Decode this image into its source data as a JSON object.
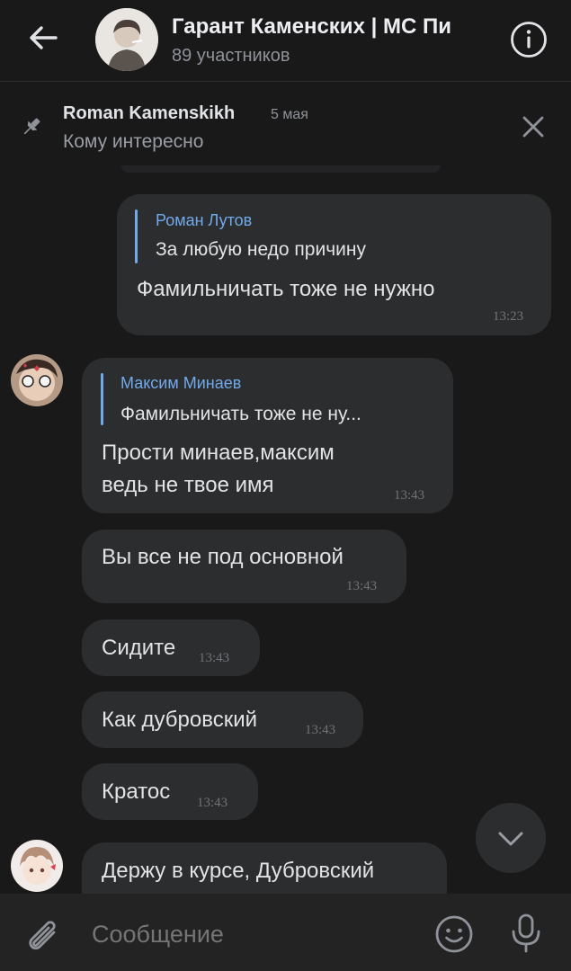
{
  "header": {
    "title": "Гарант Каменских | МС Пи",
    "subtitle": "89 участников"
  },
  "pinned": {
    "author": "Roman Kamenskikh",
    "date": "5 мая",
    "text": "Кому интересно"
  },
  "messages": [
    {
      "reply_author": "Роман Лутов",
      "reply_text": "За любую недо причину",
      "text": "Фамильничать тоже не нужно",
      "time": "13:23"
    },
    {
      "reply_author": "Максим Минаев",
      "reply_text": "Фамильничать тоже не ну...",
      "text_line1": "Прости минаев,максим",
      "text_line2": "ведь не твое имя",
      "time": "13:43"
    },
    {
      "text": "Вы все не под основной",
      "time": "13:43"
    },
    {
      "text": "Сидите",
      "time": "13:43"
    },
    {
      "text": "Как дубровский",
      "time": "13:43"
    },
    {
      "text": "Кратос",
      "time": "13:43"
    },
    {
      "text": "Держу в курсе, Дубровский"
    }
  ],
  "composer": {
    "placeholder": "Сообщение"
  },
  "icons": {
    "back": "arrow-left-icon",
    "info": "info-icon",
    "pin": "pin-icon",
    "close": "close-icon",
    "scroll": "chevron-down-icon",
    "attach": "paperclip-icon",
    "emoji": "smile-icon",
    "mic": "microphone-icon"
  },
  "colors": {
    "background": "#19191a",
    "bubble": "#2c2d2e",
    "accent": "#71aaeb",
    "text": "#e1e3e6",
    "secondary": "#8f9399"
  }
}
